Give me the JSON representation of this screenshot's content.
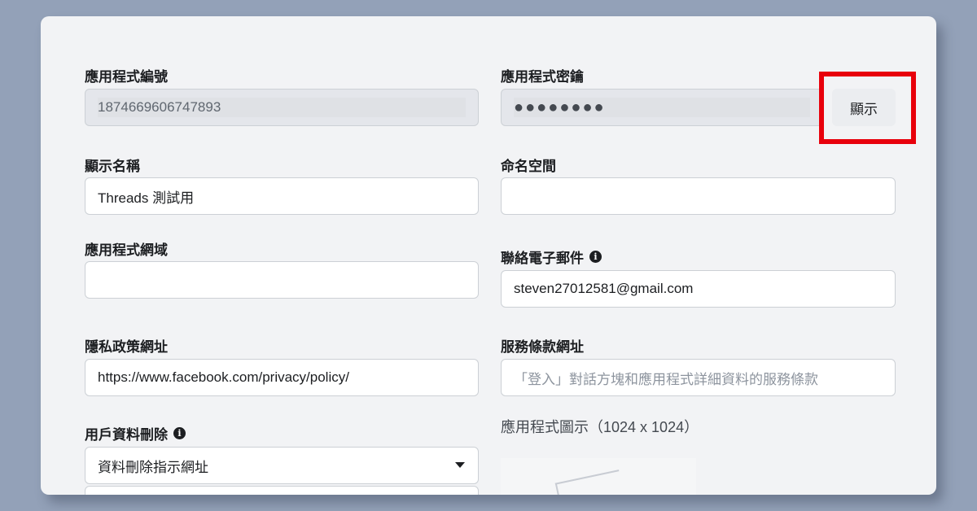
{
  "app_settings": {
    "app_id": {
      "label": "應用程式編號",
      "value": "1874669606747893"
    },
    "app_secret": {
      "label": "應用程式密鑰",
      "value": "●●●●●●●●",
      "show_button": "顯示"
    },
    "display_name": {
      "label": "顯示名稱",
      "value": "Threads 測試用"
    },
    "namespace": {
      "label": "命名空間",
      "value": ""
    },
    "app_domains": {
      "label": "應用程式網域",
      "value": ""
    },
    "contact_email": {
      "label": "聯絡電子郵件",
      "value": "steven27012581@gmail.com",
      "info_icon": "info-icon"
    },
    "privacy_policy_url": {
      "label": "隱私政策網址",
      "value": "https://www.facebook.com/privacy/policy/"
    },
    "terms_of_service_url": {
      "label": "服務條款網址",
      "placeholder": "「登入」對話方塊和應用程式詳細資料的服務條款"
    },
    "user_data_deletion": {
      "label": "用戶資料刪除",
      "selected": "資料刪除指示網址",
      "info_icon": "info-icon"
    },
    "app_icon": {
      "label": "應用程式圖示（1024 x 1024）"
    }
  },
  "colors": {
    "page_background": "#93a1b8",
    "highlight_box": "#e8000b",
    "disabled_field": "#e4e6eb",
    "button_background": "#ebedf0"
  }
}
